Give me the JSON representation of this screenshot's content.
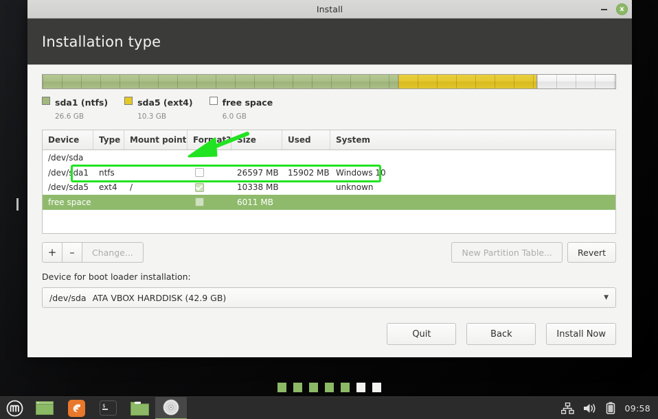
{
  "window": {
    "title": "Install",
    "minimize_label": "minimize",
    "close_label": "x",
    "page_title": "Installation type"
  },
  "partition_bar": {
    "segments": [
      {
        "name": "sda1",
        "color": "#a9bf86",
        "percent": 62.0
      },
      {
        "name": "sda5",
        "color": "#e3c72f",
        "percent": 24.2
      },
      {
        "name": "free space",
        "color": "#f2f2f2",
        "percent": 13.8
      }
    ]
  },
  "legend": [
    {
      "label": "sda1 (ntfs)",
      "size": "26.6 GB",
      "swatch": "#a2b87d"
    },
    {
      "label": "sda5 (ext4)",
      "size": "10.3 GB",
      "swatch": "#e5c927"
    },
    {
      "label": "free space",
      "size": "6.0 GB",
      "swatch": "#ffffff"
    }
  ],
  "table": {
    "columns": [
      "Device",
      "Type",
      "Mount point",
      "Format?",
      "Size",
      "Used",
      "System"
    ],
    "disk_row": "/dev/sda",
    "rows": [
      {
        "device": "/dev/sda1",
        "type": "ntfs",
        "mount": "",
        "format": false,
        "size": "26597 MB",
        "used": "15902 MB",
        "system": "Windows 10",
        "selected": false,
        "highlighted": false
      },
      {
        "device": "/dev/sda5",
        "type": "ext4",
        "mount": "/",
        "format": true,
        "size": "10338 MB",
        "used": "",
        "system": "unknown",
        "selected": false,
        "highlighted": true
      },
      {
        "device": "free space",
        "type": "",
        "mount": "",
        "format": false,
        "size": "6011 MB",
        "used": "",
        "system": "",
        "selected": true,
        "highlighted": false
      }
    ]
  },
  "mid_buttons": {
    "add": "+",
    "remove": "–",
    "change": "Change...",
    "new_partition_table": "New Partition Table...",
    "revert": "Revert"
  },
  "boot_loader": {
    "label": "Device for boot loader installation:",
    "selected_device": "/dev/sda",
    "selected_description": "ATA VBOX HARDDISK (42.9 GB)",
    "arrow": "▼"
  },
  "footer_buttons": {
    "quit": "Quit",
    "back": "Back",
    "install_now": "Install Now"
  },
  "progress_dots": {
    "total": 7,
    "filled": 5,
    "filled_color": "#8cb965",
    "empty_color": "#f2f2f0"
  },
  "taskbar": {
    "menu": "menu-button",
    "items": [
      "window-list-icon",
      "firefox-icon",
      "terminal-icon",
      "files-icon",
      "install-media-icon"
    ],
    "tray": [
      "network-icon",
      "volume-icon",
      "battery-icon"
    ],
    "clock": "09:58"
  },
  "annotations": {
    "highlight_color": "#21e321",
    "arrow_color": "#21e321",
    "highlight_target": "/dev/sda5 row",
    "arrow_target": "format checkbox column"
  }
}
